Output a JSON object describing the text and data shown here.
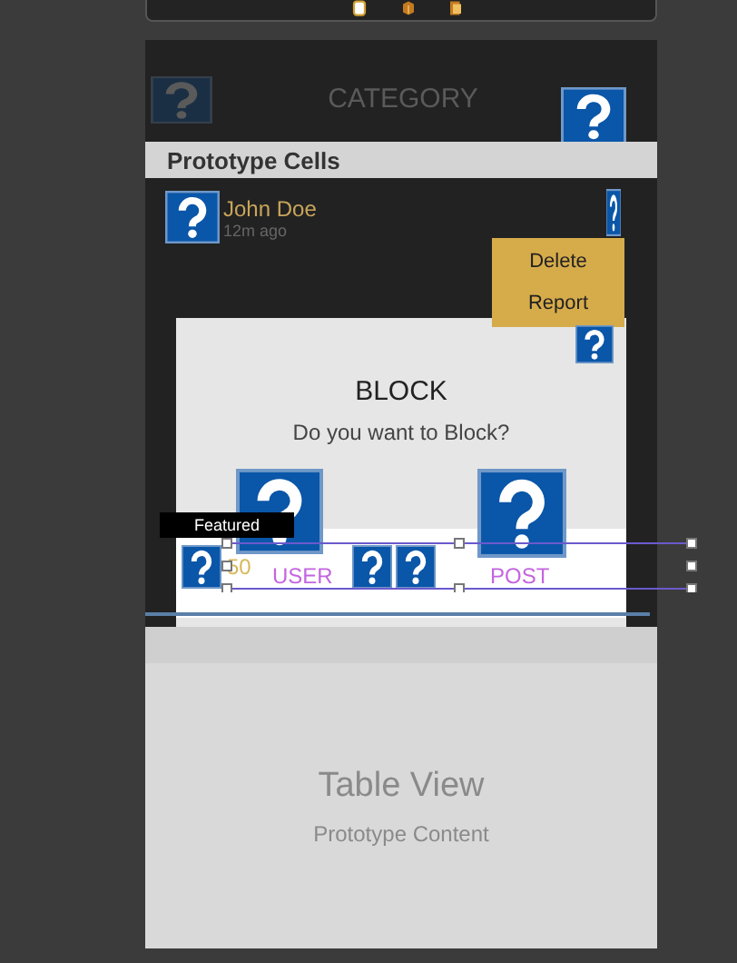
{
  "scene": {
    "header_title": "CATEGORY",
    "section_header": "Prototype Cells",
    "cell": {
      "name": "John Doe",
      "time": "12m ago"
    },
    "menu": [
      {
        "label": "Delete"
      },
      {
        "label": "Report"
      }
    ],
    "dialog": {
      "title": "BLOCK",
      "message": "Do you want to Block?"
    },
    "badge": "Featured",
    "count": "50",
    "tabs": [
      {
        "label": "USER"
      },
      {
        "label": "POST"
      }
    ]
  },
  "table_view": {
    "title": "Table View",
    "subtitle": "Prototype Content"
  }
}
